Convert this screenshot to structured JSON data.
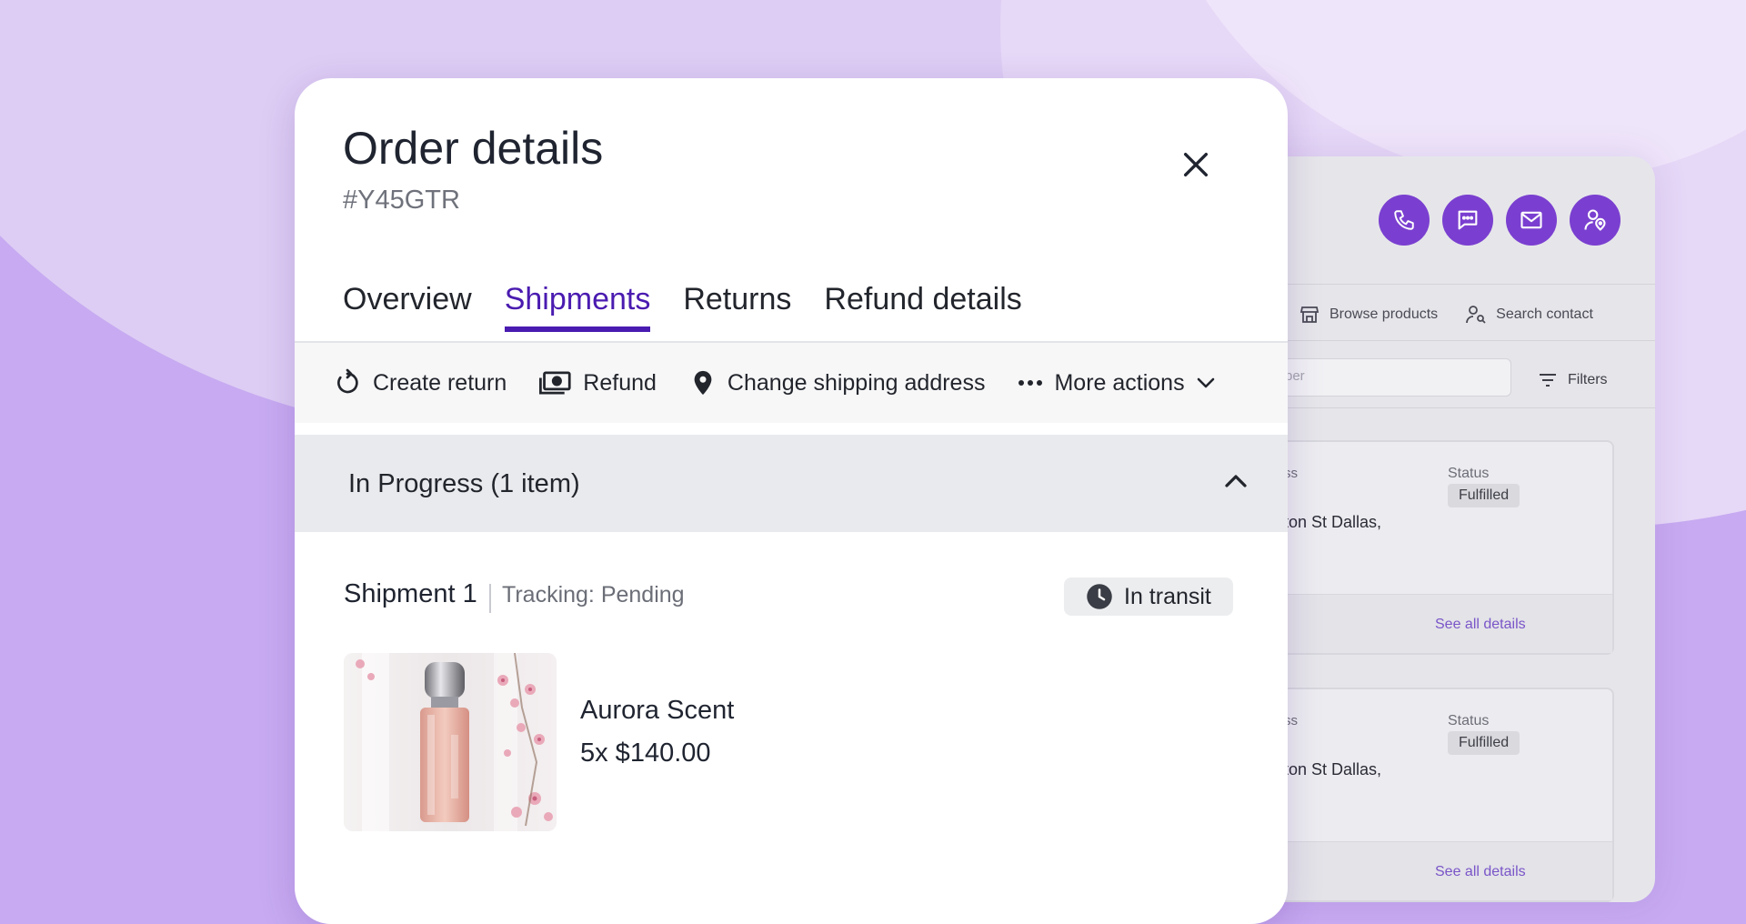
{
  "modal": {
    "title": "Order details",
    "order_id": "#Y45GTR",
    "tabs": [
      {
        "label": "Overview"
      },
      {
        "label": "Shipments"
      },
      {
        "label": "Returns"
      },
      {
        "label": "Refund details"
      }
    ],
    "active_tab": "Shipments",
    "actions": {
      "create_return": "Create return",
      "refund": "Refund",
      "change_address": "Change shipping address",
      "more_actions": "More actions"
    },
    "section": {
      "title": "In Progress (1 item)"
    },
    "shipment": {
      "title": "Shipment 1",
      "tracking": "Tracking: Pending",
      "status": "In transit"
    },
    "product": {
      "name": "Aurora Scent",
      "price": "5x $140.00"
    }
  },
  "background_panel": {
    "links": {
      "browse": "Browse products",
      "search_contact": "Search contact"
    },
    "input_placeholder": "per",
    "filters_label": "Filters",
    "cards": [
      {
        "label": "ss",
        "address": "ton St Dallas,",
        "status_label": "Status",
        "status": "Fulfilled",
        "link": "See all details"
      },
      {
        "label": "ss",
        "address": "ton St Dallas,",
        "status_label": "Status",
        "status": "Fulfilled",
        "link": "See all details"
      }
    ]
  },
  "colors": {
    "accent": "#4a1bb0",
    "contact_button": "#7a3fd0",
    "background": "#c7aaf1"
  },
  "icons": {
    "close": "close-icon",
    "create_return": "refresh-icon",
    "refund": "money-icon",
    "change_address": "location-pin-icon",
    "more_actions": "more-dots-icon",
    "chevron_down": "chevron-down-icon",
    "chevron_up": "chevron-up-icon",
    "in_transit": "clock-icon",
    "phone": "phone-icon",
    "chat": "chat-icon",
    "mail": "mail-icon",
    "contact_location": "person-location-icon",
    "store": "store-icon",
    "search_person": "person-search-icon",
    "filters": "filter-icon"
  }
}
